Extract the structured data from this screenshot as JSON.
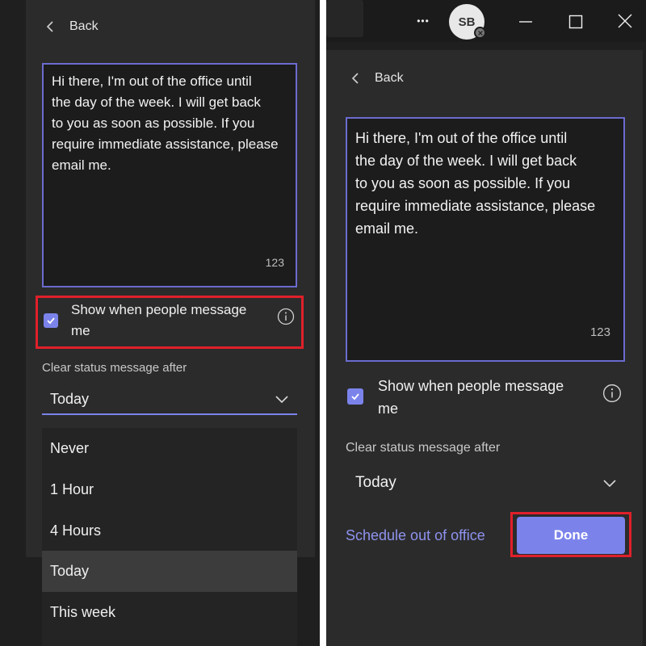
{
  "left": {
    "back_label": "Back",
    "message": "Hi there, I'm out of the office until\nthe day of the week.  I will get back\nto you as soon as possible. If you\nrequire immediate assistance, please\nemail me.",
    "char_count": "123",
    "show_when_label": "Show when people message\nme",
    "show_when_checked": true,
    "clear_label": "Clear status message after",
    "selected": "Today",
    "options": [
      "Never",
      "1 Hour",
      "4 Hours",
      "Today",
      "This week"
    ]
  },
  "right": {
    "avatar_initials": "SB",
    "more_icon": "•••",
    "back_label": "Back",
    "message": "Hi there, I'm out of the office until\nthe day of the week.  I will get back\nto you as soon as possible. If you\nrequire immediate assistance, please\nemail me.",
    "char_count": "123",
    "show_when_label": "Show when people message\nme",
    "show_when_checked": true,
    "clear_label": "Clear status message after",
    "selected": "Today",
    "schedule_label": "Schedule out of office",
    "done_label": "Done"
  },
  "colors": {
    "accent": "#7b83eb",
    "highlight": "#e0202a",
    "background": "#1f1f1f",
    "card": "#2b2b2b"
  }
}
